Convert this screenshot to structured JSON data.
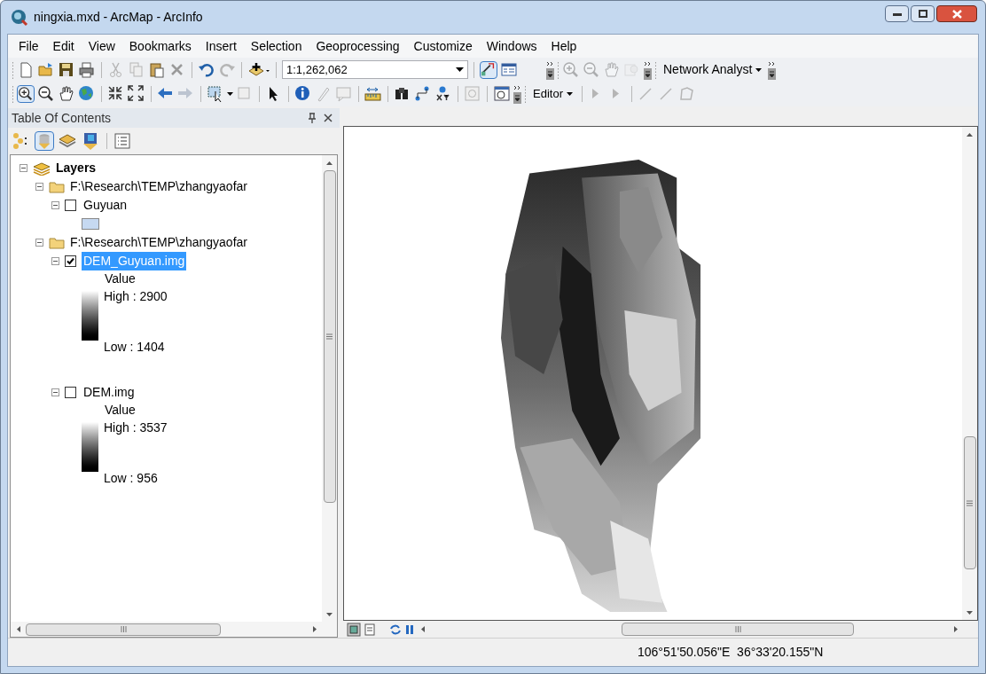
{
  "window": {
    "title": "ningxia.mxd - ArcMap - ArcInfo"
  },
  "menu": [
    "File",
    "Edit",
    "View",
    "Bookmarks",
    "Insert",
    "Selection",
    "Geoprocessing",
    "Customize",
    "Windows",
    "Help"
  ],
  "toolbar": {
    "scale": "1:1,262,062",
    "network_analyst": "Network Analyst",
    "editor": "Editor"
  },
  "toc": {
    "title": "Table Of Contents",
    "tree": {
      "label": "Layers",
      "expanded": true,
      "children": [
        {
          "label": "F:\\Research\\TEMP\\zhangyaofar",
          "expanded": true,
          "children": [
            {
              "label": "Guyuan",
              "expanded": true,
              "checked": false,
              "selected": false,
              "legend": {
                "kind": "swatch"
              }
            }
          ]
        },
        {
          "label": "F:\\Research\\TEMP\\zhangyaofar",
          "expanded": true,
          "children": [
            {
              "label": "DEM_Guyuan.img",
              "expanded": true,
              "checked": true,
              "selected": true,
              "legend": {
                "kind": "ramp",
                "title": "Value",
                "high": "High : 2900",
                "low": "Low : 1404"
              }
            },
            {
              "label": "DEM.img",
              "expanded": true,
              "checked": false,
              "selected": false,
              "legend": {
                "kind": "ramp",
                "title": "Value",
                "high": "High : 3537",
                "low": "Low : 956"
              }
            }
          ]
        }
      ]
    }
  },
  "status_bar": {
    "coordinates": "106°51'50.056\"E  36°33'20.155\"N"
  }
}
